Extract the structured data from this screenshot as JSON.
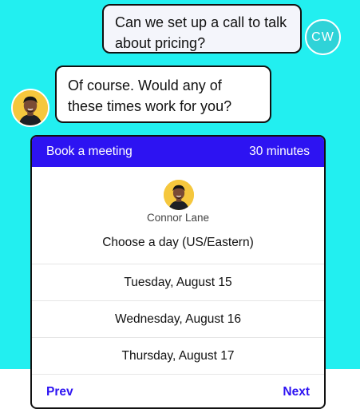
{
  "colors": {
    "background": "#22eff0",
    "accent": "#2d13f2",
    "user_avatar": "#2fd3d8"
  },
  "chat": {
    "user_message": "Can we set up a call to talk about pricing?",
    "user_initials": "CW",
    "agent_message": "Of course. Would any of these times work for you?"
  },
  "booking": {
    "title": "Book a meeting",
    "duration": "30 minutes",
    "host_name": "Connor Lane",
    "prompt": "Choose a day (US/Eastern)",
    "days": [
      "Tuesday, August 15",
      "Wednesday, August 16",
      "Thursday, August 17"
    ],
    "prev_label": "Prev",
    "next_label": "Next"
  }
}
